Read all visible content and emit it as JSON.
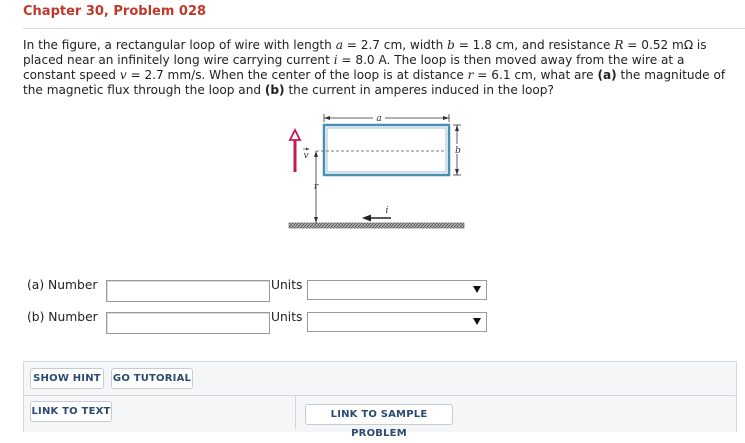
{
  "header": {
    "title": "Chapter 30, Problem 028"
  },
  "question": {
    "p1": "In the figure, a rectangular loop of wire with length ",
    "a_sym": "a",
    "p2": " = 2.7 cm, width ",
    "b_sym": "b",
    "p3": " = 1.8 cm, and resistance ",
    "R_sym": "R",
    "p4": " = 0.52 mΩ is placed near an infinitely long wire carrying current ",
    "i_sym": "i",
    "p5": " = 8.0 A. The loop is then moved away from the wire at a constant speed ",
    "v_sym": "v",
    "p6": " = 2.7 mm/s. When the center of the loop is at distance ",
    "r_sym": "r",
    "p7": " = 6.1 cm, what are ",
    "part_a": "(a)",
    "p8": " the magnitude of the magnetic flux through the loop and ",
    "part_b": "(b)",
    "p9": " the current in amperes induced in the loop?"
  },
  "figure": {
    "label_a": "a",
    "label_b": "b",
    "label_v": "v",
    "label_r": "r",
    "label_i": "i",
    "colors": {
      "loop": "#4b8fb0",
      "velocity": "#c2185b",
      "wire": "#555555"
    }
  },
  "answers": [
    {
      "label": "(a) Number",
      "value": "",
      "units_label": "Units",
      "units_value": ""
    },
    {
      "label": "(b) Number",
      "value": "",
      "units_label": "Units",
      "units_value": ""
    }
  ],
  "buttons": {
    "show_hint": "SHOW HINT",
    "go_tutorial": "GO TUTORIAL",
    "link_to_text": "LINK TO TEXT",
    "link_to_sample": "LINK TO SAMPLE PROBLEM"
  }
}
